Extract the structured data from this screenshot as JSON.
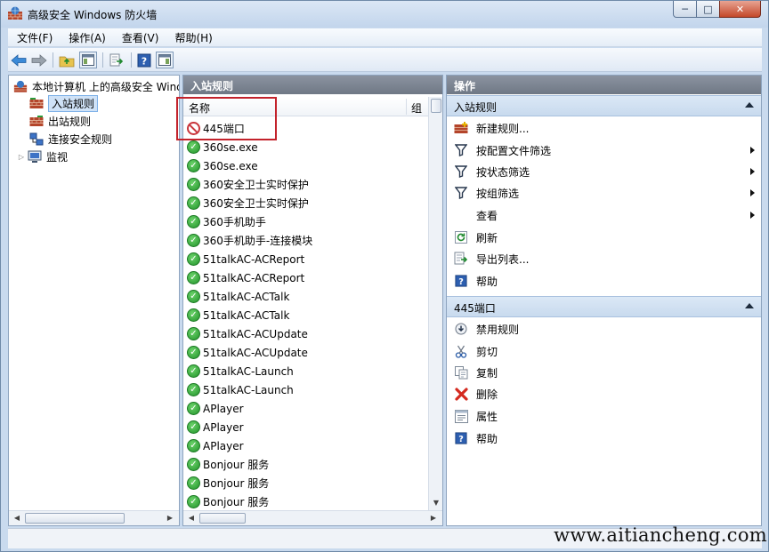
{
  "window": {
    "title": "高级安全 Windows 防火墙",
    "controls": {
      "minimize": "─",
      "maximize": "□",
      "close": "✕"
    }
  },
  "menu": [
    "文件(F)",
    "操作(A)",
    "查看(V)",
    "帮助(H)"
  ],
  "tree": {
    "root": "本地计算机 上的高级安全 Windows 防火墙",
    "items": [
      "入站规则",
      "出站规则",
      "连接安全规则",
      "监视"
    ]
  },
  "middle": {
    "header": "入站规则",
    "col_name": "名称",
    "col_group": "组",
    "rules": [
      "445端口",
      "360se.exe",
      "360se.exe",
      "360安全卫士实时保护",
      "360安全卫士实时保护",
      "360手机助手",
      "360手机助手-连接模块",
      "51talkAC-ACReport",
      "51talkAC-ACReport",
      "51talkAC-ACTalk",
      "51talkAC-ACTalk",
      "51talkAC-ACUpdate",
      "51talkAC-ACUpdate",
      "51talkAC-Launch",
      "51talkAC-Launch",
      "APlayer",
      "APlayer",
      "APlayer",
      "Bonjour 服务",
      "Bonjour 服务",
      "Bonjour 服务"
    ]
  },
  "actions": {
    "header": "操作",
    "section1": {
      "title": "入站规则",
      "items": [
        "新建规则...",
        "按配置文件筛选",
        "按状态筛选",
        "按组筛选",
        "查看",
        "刷新",
        "导出列表...",
        "帮助"
      ]
    },
    "section2": {
      "title": "445端口",
      "items": [
        "禁用规则",
        "剪切",
        "复制",
        "删除",
        "属性",
        "帮助"
      ]
    }
  },
  "watermark": "www.aitiancheng.com",
  "colors": {
    "enabled": "#22932b",
    "disabled": "#c9363c",
    "highlight": "#c3222b"
  }
}
